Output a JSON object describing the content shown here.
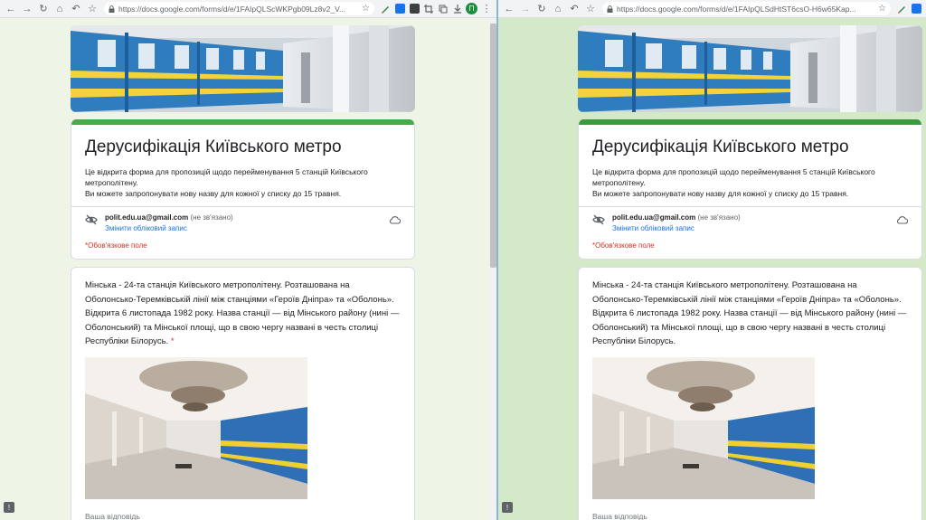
{
  "left": {
    "url": "https://docs.google.com/forms/d/e/1FAIpQLScWKPgb09Lz8v2_V...",
    "avatar_letter": "П"
  },
  "right": {
    "url": "https://docs.google.com/forms/d/e/1FAIpQLSdHtST6csO-H6w65Kap..."
  },
  "form": {
    "title": "Дерусифікація Київського метро",
    "description_1": "Це відкрита форма для пропозицій щодо перейменування 5 станцій Київського метрополітену.",
    "description_2": "Ви можете запропонувати нову назву для кожної у списку до 15 травня.",
    "account_email": "polit.edu.ua@gmail.com",
    "account_status": "(не зв'язано)",
    "switch_account": "Змінити обліковий запис",
    "required_note": "*Обов'язкове поле"
  },
  "question": {
    "text": "Мінська - 24-та станція Київського метрополітену. Розташована на Оболонсько-Теремківській лінії між станціями «Героїв Дніпра» та «Оболонь». Відкрита 6 листопада 1982 року. Назва станції — від Мінського району (нині — Оболонський) та Мінської площі, що в свою чергу названі в честь столиці Республіки Білорусь.",
    "required_mark": "*",
    "answer_label_left": "Ваша відповідь",
    "answer_label_right": "Ваша відповідь"
  },
  "icons": {
    "back": "back-arrow-icon",
    "forward": "forward-arrow-icon",
    "reload": "reload-icon",
    "home": "home-icon",
    "undo": "undo-icon",
    "bookmark": "star-icon",
    "hidden": "eye-off-icon",
    "cloud": "cloud-save-icon",
    "feedback": "feedback-icon"
  },
  "colors": {
    "accent": "#45ab4d",
    "link": "#1a73e8",
    "required": "#d93025",
    "left_bg": "#eef5e7",
    "right_bg": "#d4e9c8"
  }
}
